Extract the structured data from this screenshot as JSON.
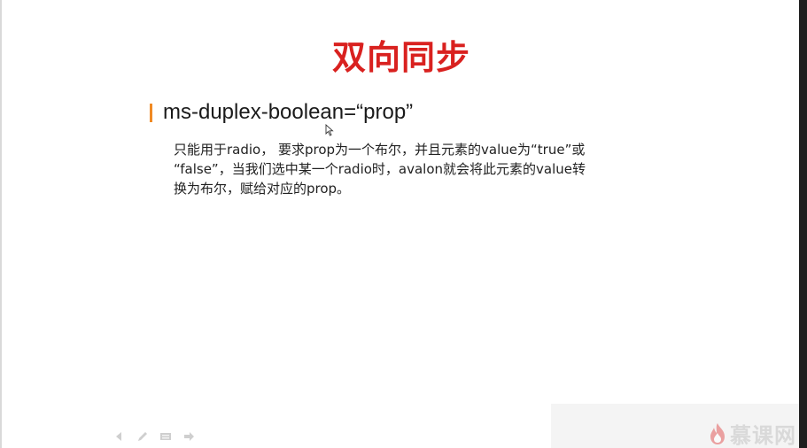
{
  "slide": {
    "title": "双向同步",
    "heading": "ms-duplex-boolean=“prop”",
    "body_lines": [
      "只能用于radio， 要求prop为一个布尔，并且元素的value为“true”或",
      "“false”，当我们选中某一个radio时，avalon就会将此元素的value转",
      "换为布尔，赋给对应的prop。"
    ]
  },
  "colors": {
    "title": "#d9211f",
    "bullet_accent": "#f08a24",
    "text": "#222222"
  },
  "toolbar": {
    "icons": [
      "arrow-left-icon",
      "pen-icon",
      "slides-icon",
      "arrow-right-icon"
    ]
  },
  "watermark": {
    "logo": "flame-icon",
    "text": "慕课网"
  }
}
